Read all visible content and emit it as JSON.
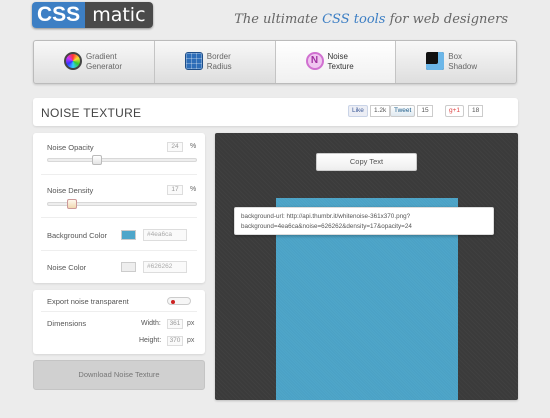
{
  "header": {
    "logo_css": "CSS",
    "logo_matic": "matic",
    "tagline_pre": "The ultimate ",
    "tagline_accent": "CSS tools",
    "tagline_post": " for web designers"
  },
  "tabs": [
    {
      "label": "Gradient\nGenerator",
      "icon": "gradient-wheel-icon",
      "active": false
    },
    {
      "label": "Border\nRadius",
      "icon": "border-radius-icon",
      "active": false
    },
    {
      "label": "Noise\nTexture",
      "icon": "noise-texture-icon",
      "active": true
    },
    {
      "label": "Box\nShadow",
      "icon": "box-shadow-icon",
      "active": false
    }
  ],
  "title": "NOISE TEXTURE",
  "share": {
    "like_label": "Like",
    "like_count": "1.2k",
    "tweet_label": "Tweet",
    "tweet_count": "15",
    "gplus_label": "+1",
    "gplus_count": "18"
  },
  "controls": {
    "opacity_label": "Noise Opacity",
    "opacity_value": "24",
    "opacity_unit": "%",
    "opacity_fraction": 0.24,
    "density_label": "Noise Density",
    "density_value": "17",
    "density_unit": "%",
    "density_fraction": 0.17,
    "bg_color_label": "Background Color",
    "bg_color_value": "#4ea6ca",
    "noise_color_label": "Noise Color",
    "noise_color_value": "#626262",
    "export_label": "Export noise transparent",
    "dimensions_label": "Dimensions",
    "width_label": "Width:",
    "width_value": "361",
    "width_unit": "px",
    "height_label": "Height:",
    "height_value": "370",
    "height_unit": "px",
    "download_label": "Download Noise Texture"
  },
  "preview": {
    "copy_label": "Copy Text",
    "code_line1": "background-url: http://api.thumbr.it/whitenoise-361x370.png?",
    "code_line2": "background=4ea6ca&noise=626262&density=17&opacity=24"
  },
  "colors": {
    "brand": "#3d7fc4",
    "stage": "#3b3b3b",
    "swatch_bg": "#4ea6ca",
    "swatch_noise": "#eeeeee",
    "toggle_dot": "#cc2222"
  }
}
